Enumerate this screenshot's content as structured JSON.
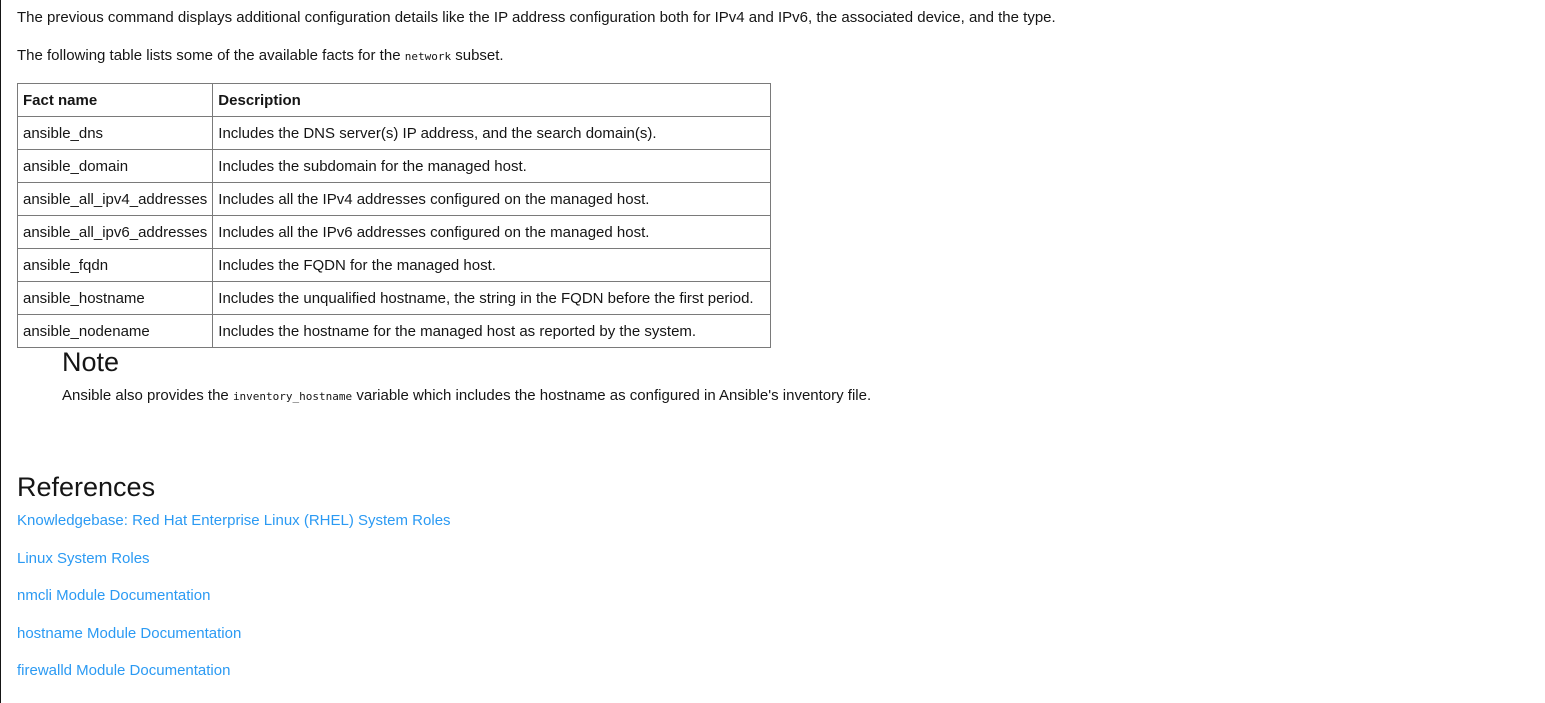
{
  "intro": {
    "paragraph": "The previous command displays additional configuration details like the IP address configuration both for IPv4 and IPv6, the associated device, and the type.",
    "table_lead_before": "The following table lists some of the available facts for the ",
    "table_lead_code": "network",
    "table_lead_after": " subset."
  },
  "facts_table": {
    "headers": [
      "Fact name",
      "Description"
    ],
    "rows": [
      [
        "ansible_dns",
        "Includes the DNS server(s) IP address, and the search domain(s)."
      ],
      [
        "ansible_domain",
        "Includes the subdomain for the managed host."
      ],
      [
        "ansible_all_ipv4_addresses",
        "Includes all the IPv4 addresses configured on the managed host."
      ],
      [
        "ansible_all_ipv6_addresses",
        "Includes all the IPv6 addresses configured on the managed host."
      ],
      [
        "ansible_fqdn",
        "Includes the FQDN for the managed host."
      ],
      [
        "ansible_hostname",
        "Includes the unqualified hostname, the string in the FQDN before the first period."
      ],
      [
        "ansible_nodename",
        "Includes the hostname for the managed host as reported by the system."
      ]
    ]
  },
  "note": {
    "title": "Note",
    "text_before": "Ansible also provides the ",
    "code": "inventory_hostname",
    "text_after": " variable which includes the hostname as configured in Ansible's inventory file."
  },
  "references": {
    "title": "References",
    "links": [
      "Knowledgebase: Red Hat Enterprise Linux (RHEL) System Roles",
      "Linux System Roles",
      "nmcli Module Documentation",
      "hostname Module Documentation",
      "firewalld Module Documentation"
    ]
  },
  "colors": {
    "link": "#2b9af3",
    "text": "#151515",
    "table_border": "#7a7a7a"
  }
}
